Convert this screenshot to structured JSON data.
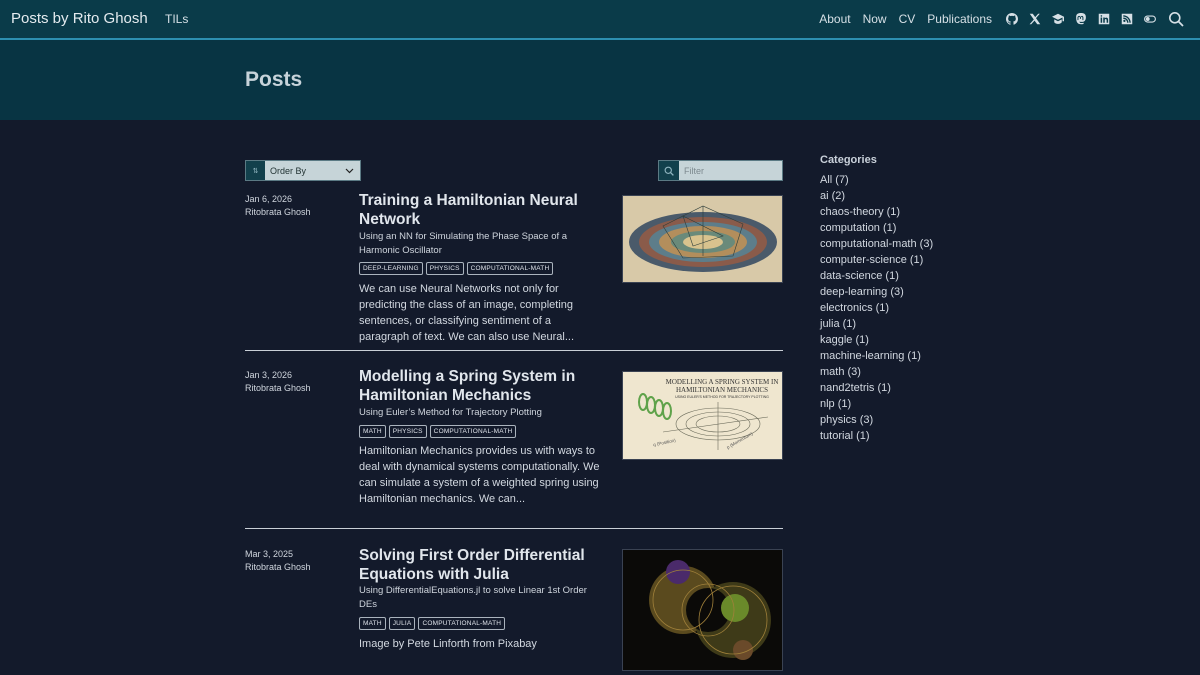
{
  "nav": {
    "brand": "Posts by Rito Ghosh",
    "til": "TILs",
    "links": [
      "About",
      "Now",
      "CV",
      "Publications"
    ],
    "icons": [
      "github-icon",
      "x-twitter-icon",
      "graduation-cap-icon",
      "mastodon-icon",
      "linkedin-icon",
      "rss-icon",
      "toggle-icon",
      "search-icon"
    ]
  },
  "page": {
    "title": "Posts"
  },
  "controls": {
    "order_by": "Order By",
    "sort_glyph": "⇅",
    "filter_placeholder": "Filter"
  },
  "posts": [
    {
      "date": "Jan 6, 2026",
      "author": "Ritobrata Ghosh",
      "title": "Training a Hamiltonian Neural Network",
      "subtitle": "Using an NN for Simulating the Phase Space of a Harmonic Oscillator",
      "tags": [
        "DEEP-LEARNING",
        "PHYSICS",
        "COMPUTATIONAL-MATH"
      ],
      "excerpt": "We can use Neural Networks not only for predicting the class of an image, completing sentences, or classifying sentiment of a paragraph of text. We can also use Neural..."
    },
    {
      "date": "Jan 3, 2026",
      "author": "Ritobrata Ghosh",
      "title": "Modelling a Spring System in Hamiltonian Mechanics",
      "subtitle": "Using Euler’s Method for Trajectory Plotting",
      "tags": [
        "MATH",
        "PHYSICS",
        "COMPUTATIONAL-MATH"
      ],
      "excerpt": "Hamiltonian Mechanics provides us with ways to deal with dynamical systems computationally. We can simulate a system of a weighted spring using Hamiltonian mechanics. We can...",
      "thumb_title_1": "MODELLING A SPRING SYSTEM IN",
      "thumb_title_2": "HAMILTONIAN MECHANICS",
      "thumb_sub": "USING EULER'S METHOD FOR TRAJECTORY PLOTTING",
      "thumb_axis_q": "q (Position)",
      "thumb_axis_p": "p (Momentum)"
    },
    {
      "date": "Mar 3, 2025",
      "author": "Ritobrata Ghosh",
      "title": "Solving First Order Differential Equations with Julia",
      "subtitle": "Using DifferentialEquations.jl to solve Linear 1st Order DEs",
      "tags": [
        "MATH",
        "JULIA",
        "COMPUTATIONAL-MATH"
      ],
      "excerpt": "Image by Pete Linforth from Pixabay"
    }
  ],
  "sidebar": {
    "title": "Categories",
    "categories": [
      "All (7)",
      "ai (2)",
      "chaos-theory (1)",
      "computation (1)",
      "computational-math (3)",
      "computer-science (1)",
      "data-science (1)",
      "deep-learning (3)",
      "electronics (1)",
      "julia (1)",
      "kaggle (1)",
      "machine-learning (1)",
      "math (3)",
      "nand2tetris (1)",
      "nlp (1)",
      "physics (3)",
      "tutorial (1)"
    ]
  }
}
